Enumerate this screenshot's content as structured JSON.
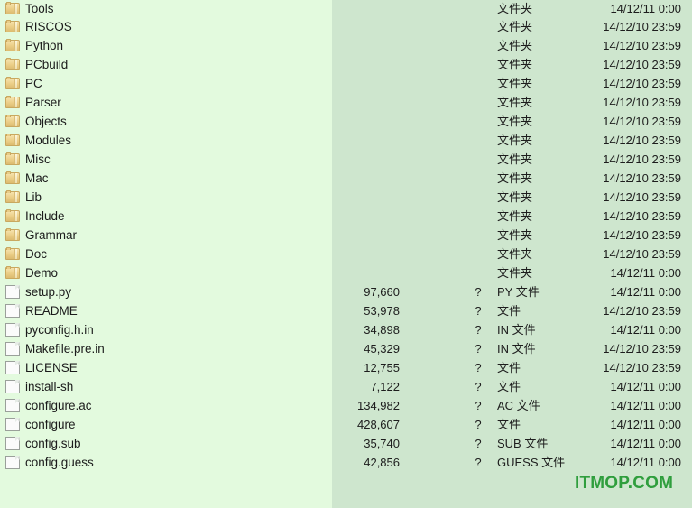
{
  "colors": {
    "left_panel_bg": "#e3fade",
    "detail_panel_bg": "#cee6ce",
    "text": "#1d1d1d",
    "watermark": "#2f9e3d"
  },
  "watermark": {
    "text": "ITMOP.COM"
  },
  "columns": {
    "name": "",
    "size": "",
    "ratio": "",
    "type": "",
    "date": ""
  },
  "rows": [
    {
      "icon": "folder-icon",
      "name": "Tools",
      "size": "",
      "ratio": "",
      "type": "文件夹",
      "date": "14/12/11 0:00"
    },
    {
      "icon": "folder-icon",
      "name": "RISCOS",
      "size": "",
      "ratio": "",
      "type": "文件夹",
      "date": "14/12/10 23:59"
    },
    {
      "icon": "folder-icon",
      "name": "Python",
      "size": "",
      "ratio": "",
      "type": "文件夹",
      "date": "14/12/10 23:59"
    },
    {
      "icon": "folder-icon",
      "name": "PCbuild",
      "size": "",
      "ratio": "",
      "type": "文件夹",
      "date": "14/12/10 23:59"
    },
    {
      "icon": "folder-icon",
      "name": "PC",
      "size": "",
      "ratio": "",
      "type": "文件夹",
      "date": "14/12/10 23:59"
    },
    {
      "icon": "folder-icon",
      "name": "Parser",
      "size": "",
      "ratio": "",
      "type": "文件夹",
      "date": "14/12/10 23:59"
    },
    {
      "icon": "folder-icon",
      "name": "Objects",
      "size": "",
      "ratio": "",
      "type": "文件夹",
      "date": "14/12/10 23:59"
    },
    {
      "icon": "folder-icon",
      "name": "Modules",
      "size": "",
      "ratio": "",
      "type": "文件夹",
      "date": "14/12/10 23:59"
    },
    {
      "icon": "folder-icon",
      "name": "Misc",
      "size": "",
      "ratio": "",
      "type": "文件夹",
      "date": "14/12/10 23:59"
    },
    {
      "icon": "folder-icon",
      "name": "Mac",
      "size": "",
      "ratio": "",
      "type": "文件夹",
      "date": "14/12/10 23:59"
    },
    {
      "icon": "folder-icon",
      "name": "Lib",
      "size": "",
      "ratio": "",
      "type": "文件夹",
      "date": "14/12/10 23:59"
    },
    {
      "icon": "folder-icon",
      "name": "Include",
      "size": "",
      "ratio": "",
      "type": "文件夹",
      "date": "14/12/10 23:59"
    },
    {
      "icon": "folder-icon",
      "name": "Grammar",
      "size": "",
      "ratio": "",
      "type": "文件夹",
      "date": "14/12/10 23:59"
    },
    {
      "icon": "folder-icon",
      "name": "Doc",
      "size": "",
      "ratio": "",
      "type": "文件夹",
      "date": "14/12/10 23:59"
    },
    {
      "icon": "folder-icon",
      "name": "Demo",
      "size": "",
      "ratio": "",
      "type": "文件夹",
      "date": "14/12/11 0:00"
    },
    {
      "icon": "file-icon",
      "name": "setup.py",
      "size": "97,660",
      "ratio": "?",
      "type": "PY 文件",
      "date": "14/12/11 0:00"
    },
    {
      "icon": "file-icon",
      "name": "README",
      "size": "53,978",
      "ratio": "?",
      "type": "文件",
      "date": "14/12/10 23:59"
    },
    {
      "icon": "file-icon",
      "name": "pyconfig.h.in",
      "size": "34,898",
      "ratio": "?",
      "type": "IN 文件",
      "date": "14/12/11 0:00"
    },
    {
      "icon": "file-icon",
      "name": "Makefile.pre.in",
      "size": "45,329",
      "ratio": "?",
      "type": "IN 文件",
      "date": "14/12/10 23:59"
    },
    {
      "icon": "file-icon",
      "name": "LICENSE",
      "size": "12,755",
      "ratio": "?",
      "type": "文件",
      "date": "14/12/10 23:59"
    },
    {
      "icon": "file-icon",
      "name": "install-sh",
      "size": "7,122",
      "ratio": "?",
      "type": "文件",
      "date": "14/12/11 0:00"
    },
    {
      "icon": "file-icon",
      "name": "configure.ac",
      "size": "134,982",
      "ratio": "?",
      "type": "AC 文件",
      "date": "14/12/11 0:00"
    },
    {
      "icon": "file-icon",
      "name": "configure",
      "size": "428,607",
      "ratio": "?",
      "type": "文件",
      "date": "14/12/11 0:00"
    },
    {
      "icon": "file-icon",
      "name": "config.sub",
      "size": "35,740",
      "ratio": "?",
      "type": "SUB 文件",
      "date": "14/12/11 0:00"
    },
    {
      "icon": "file-icon",
      "name": "config.guess",
      "size": "42,856",
      "ratio": "?",
      "type": "GUESS 文件",
      "date": "14/12/11 0:00"
    }
  ]
}
